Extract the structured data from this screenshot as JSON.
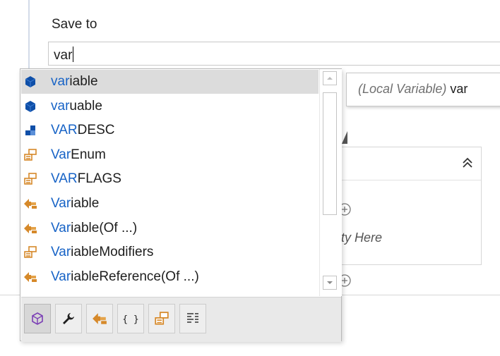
{
  "field": {
    "label": "Save to",
    "value": "var"
  },
  "tooltip": {
    "kind": "(Local Variable)",
    "name": "var"
  },
  "activity": {
    "drop_hint": "ivity Here"
  },
  "completion": {
    "items": [
      {
        "match": "var",
        "rest": "iable",
        "icon": "local-variable-icon",
        "selected": true
      },
      {
        "match": "var",
        "rest": "uable",
        "icon": "local-variable-icon"
      },
      {
        "match": "VAR",
        "rest": "DESC",
        "icon": "structure-icon"
      },
      {
        "match": "Var",
        "rest": "Enum",
        "icon": "enum-icon"
      },
      {
        "match": "VAR",
        "rest": "FLAGS",
        "icon": "enum-icon"
      },
      {
        "match": "Var",
        "rest": "iable",
        "icon": "activity-icon"
      },
      {
        "match": "Var",
        "rest": "iable(Of ...)",
        "icon": "activity-icon"
      },
      {
        "match": "Var",
        "rest": "iableModifiers",
        "icon": "enum-icon"
      },
      {
        "match": "Var",
        "rest": "iableReference(Of ...)",
        "icon": "activity-icon"
      }
    ],
    "filters": [
      {
        "icon": "cube-icon",
        "active": true
      },
      {
        "icon": "wrench-icon"
      },
      {
        "icon": "activity-icon"
      },
      {
        "icon": "braces-icon"
      },
      {
        "icon": "enum-icon"
      },
      {
        "icon": "snippet-icon"
      }
    ]
  },
  "colors": {
    "match_text": "#1763c6",
    "selection": "#dcdcdc",
    "icon_blue": "#0f4fa8",
    "icon_orange": "#d6892a"
  }
}
